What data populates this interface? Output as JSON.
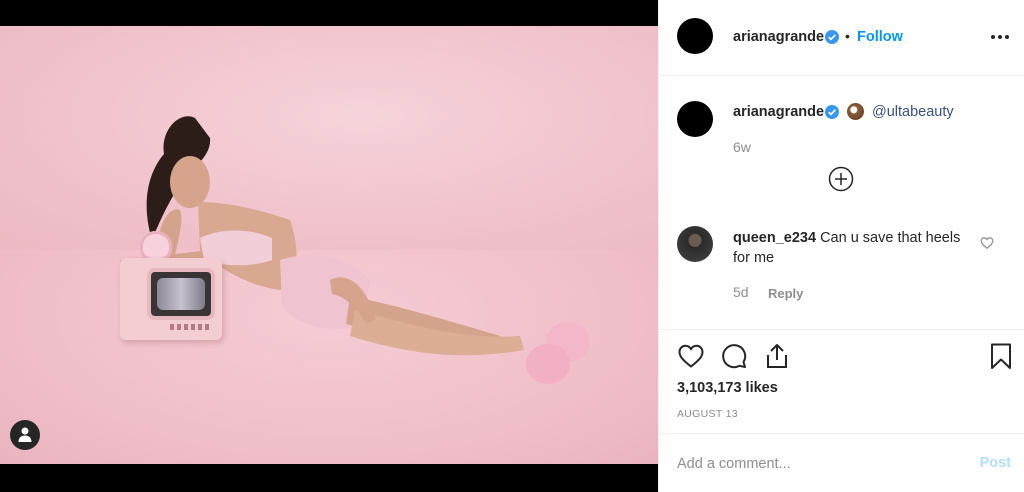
{
  "post": {
    "author": "arianagrande",
    "follow_label": "Follow",
    "dot": "•",
    "caption": {
      "author": "arianagrande",
      "emoji": "coconut-emoji",
      "mention": "@ultabeauty",
      "time": "6w"
    },
    "comments": [
      {
        "user": "queen_e234",
        "text": "Can u save that heels for me",
        "time": "5d",
        "reply_label": "Reply"
      }
    ],
    "likes": "3,103,173 likes",
    "date": "AUGUST 13",
    "add_comment_placeholder": "Add a comment...",
    "post_label": "Post"
  },
  "icons": {
    "verified": "verified-badge-icon",
    "more": "more-options-icon",
    "load_more": "plus-circle-icon",
    "like": "heart-icon",
    "comment": "comment-bubble-icon",
    "share": "share-icon",
    "save": "bookmark-icon",
    "tagged_user": "user-tag-icon"
  },
  "colors": {
    "accent": "#0095f6",
    "mention": "#385185",
    "muted": "#8e8e8e",
    "post_disabled": "#b2dffc",
    "photo_background": "#f3c4cf"
  }
}
